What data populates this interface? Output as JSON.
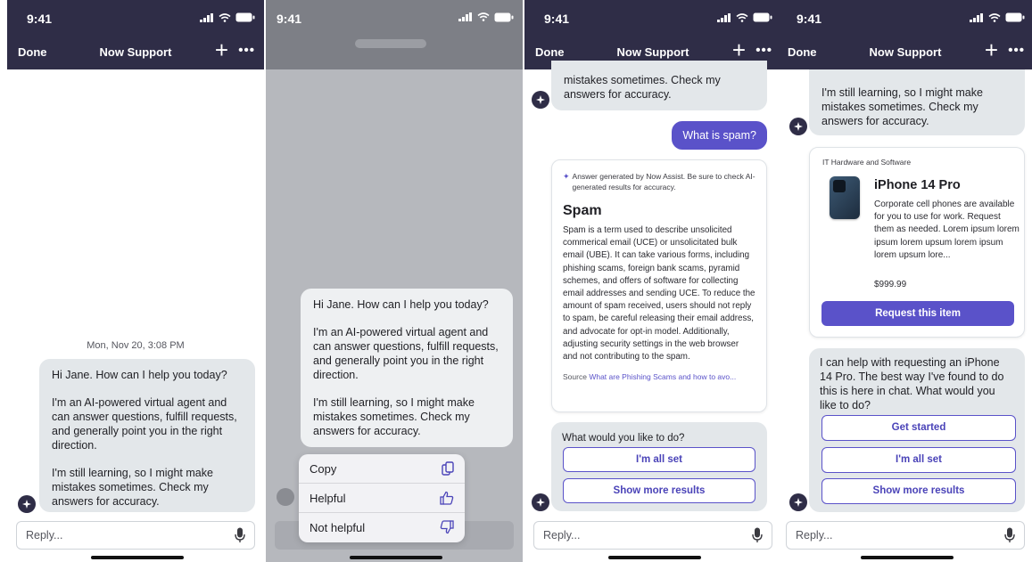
{
  "status": {
    "time": "9:41"
  },
  "nav": {
    "done": "Done",
    "title": "Now Support",
    "plus": "+",
    "more": "•••"
  },
  "reply": {
    "placeholder": "Reply..."
  },
  "screen1": {
    "timestamp": "Mon, Nov 20, 3:08 PM",
    "greeting": "Hi Jane. How can I help you today?",
    "intro": "I'm an AI-powered virtual agent and can answer questions, fulfill requests, and generally point you in the right direction.",
    "disclaimer": "I'm still learning, so I might make mistakes sometimes. Check my answers for accuracy."
  },
  "screen2": {
    "greeting": "Hi Jane. How can I help you today?",
    "intro": "I'm an AI-powered virtual agent and can answer questions, fulfill requests, and generally point you in the right direction.",
    "disclaimer": "I'm still learning, so I might make mistakes sometimes. Check my answers for accuracy.",
    "menu": {
      "copy": "Copy",
      "helpful": "Helpful",
      "not_helpful": "Not helpful"
    }
  },
  "screen3": {
    "prev_text": "mistakes sometimes. Check my answers for accuracy.",
    "user_question": "What is spam?",
    "ai_notice": "Answer generated by Now Assist. Be sure to check AI-generated results for accuracy.",
    "answer_title": "Spam",
    "answer_body": "Spam is a term used to describe unsolicited commerical email (UCE) or unsolicitated bulk email (UBE). It can take various forms, including phishing scams, foreign bank scams, pyramid schemes, and offers of software for collecting email addresses and sending UCE. To reduce the amount of spam received, users should not reply to spam, be careful releasing their email address, and advocate for opt-in model. Additionally, adjusting security settings in the web browser and not contributing to the spam.",
    "source_label": "Source",
    "source_link": "What are Phishing Scams and how to avo...",
    "question": "What would you like to do?",
    "btn_all_set": "I'm all set",
    "btn_more": "Show more results"
  },
  "screen4": {
    "prev_text": "I'm still learning, so I might make mistakes sometimes. Check my answers for accuracy.",
    "category": "IT Hardware and Software",
    "product_name": "iPhone 14 Pro",
    "product_desc": "Corporate cell phones are available for you to use for work. Request them as needed. Lorem ipsum lorem ipsum lorem upsum lorem ipsum lorem upsum lore...",
    "price": "$999.99",
    "btn_request": "Request this item",
    "help_text": "I can help with requesting an iPhone 14 Pro. The best way I've found to do this is here in chat. What would you like to do?",
    "btn_started": "Get started",
    "btn_all_set": "I'm all set",
    "btn_more": "Show more results"
  },
  "colors": {
    "nav_bg": "#2f2d47",
    "accent": "#5a52c9",
    "bubble_bg": "#e3e7ea"
  }
}
